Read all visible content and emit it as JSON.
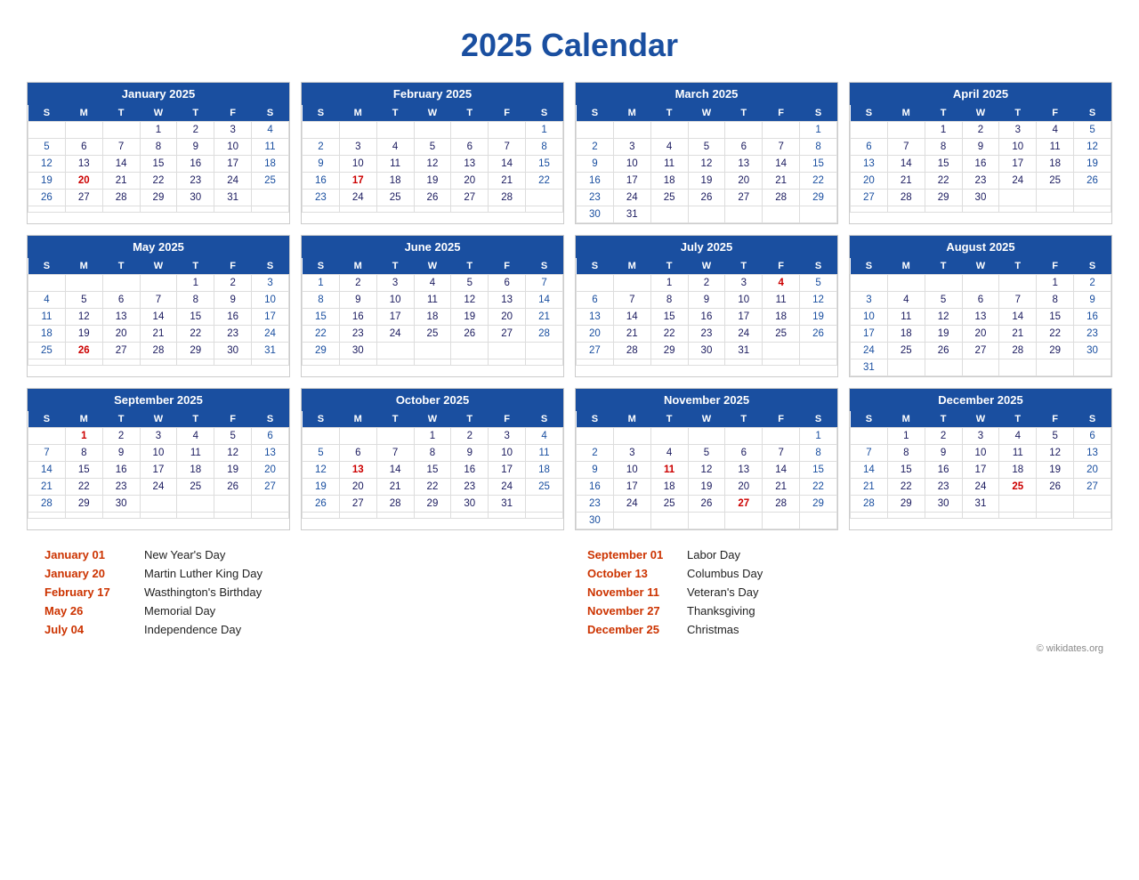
{
  "title": "2025 Calendar",
  "months": [
    {
      "name": "January 2025",
      "weeks": [
        [
          "",
          "",
          "",
          "1",
          "2",
          "3",
          "4"
        ],
        [
          "5",
          "6",
          "7",
          "8",
          "9",
          "10",
          "11"
        ],
        [
          "12",
          "13",
          "14",
          "15",
          "16",
          "17",
          "18"
        ],
        [
          "19",
          "20h",
          "21",
          "22",
          "23",
          "24",
          "25"
        ],
        [
          "26",
          "27",
          "28",
          "29",
          "30",
          "31",
          ""
        ],
        [
          "",
          "",
          "",
          "",
          "",
          "",
          ""
        ]
      ],
      "holidays": [
        "1",
        "20"
      ]
    },
    {
      "name": "February 2025",
      "weeks": [
        [
          "",
          "",
          "",
          "",
          "",
          "",
          "1"
        ],
        [
          "2",
          "3",
          "4",
          "5",
          "6",
          "7",
          "8"
        ],
        [
          "9",
          "10",
          "11",
          "12",
          "13",
          "14",
          "15"
        ],
        [
          "16",
          "17h",
          "18",
          "19",
          "20",
          "21",
          "22"
        ],
        [
          "23",
          "24",
          "25",
          "26",
          "27",
          "28",
          ""
        ],
        [
          "",
          "",
          "",
          "",
          "",
          "",
          ""
        ]
      ],
      "holidays": [
        "17"
      ]
    },
    {
      "name": "March 2025",
      "weeks": [
        [
          "",
          "",
          "",
          "",
          "",
          "",
          "1"
        ],
        [
          "2",
          "3",
          "4",
          "5",
          "6",
          "7",
          "8"
        ],
        [
          "9",
          "10",
          "11",
          "12",
          "13",
          "14",
          "15"
        ],
        [
          "16",
          "17",
          "18",
          "19",
          "20",
          "21",
          "22"
        ],
        [
          "23",
          "24",
          "25",
          "26",
          "27",
          "28",
          "29"
        ],
        [
          "30",
          "31",
          "",
          "",
          "",
          "",
          ""
        ]
      ],
      "holidays": []
    },
    {
      "name": "April 2025",
      "weeks": [
        [
          "",
          "",
          "1",
          "2",
          "3",
          "4",
          "5"
        ],
        [
          "6",
          "7",
          "8",
          "9",
          "10",
          "11",
          "12"
        ],
        [
          "13",
          "14",
          "15",
          "16",
          "17",
          "18",
          "19"
        ],
        [
          "20",
          "21",
          "22",
          "23",
          "24",
          "25",
          "26"
        ],
        [
          "27",
          "28",
          "29",
          "30",
          "",
          "",
          ""
        ],
        [
          "",
          "",
          "",
          "",
          "",
          "",
          ""
        ]
      ],
      "holidays": []
    },
    {
      "name": "May 2025",
      "weeks": [
        [
          "",
          "",
          "",
          "",
          "1",
          "2",
          "3"
        ],
        [
          "4",
          "5",
          "6",
          "7",
          "8",
          "9",
          "10"
        ],
        [
          "11",
          "12",
          "13",
          "14",
          "15",
          "16",
          "17"
        ],
        [
          "18",
          "19",
          "20",
          "21",
          "22",
          "23",
          "24"
        ],
        [
          "25",
          "26h",
          "27",
          "28",
          "29",
          "30",
          "31"
        ],
        [
          "",
          "",
          "",
          "",
          "",
          "",
          ""
        ]
      ],
      "holidays": [
        "26"
      ]
    },
    {
      "name": "June 2025",
      "weeks": [
        [
          "1",
          "2",
          "3",
          "4",
          "5",
          "6",
          "7"
        ],
        [
          "8",
          "9",
          "10",
          "11",
          "12",
          "13",
          "14"
        ],
        [
          "15",
          "16",
          "17",
          "18",
          "19",
          "20",
          "21"
        ],
        [
          "22",
          "23",
          "24",
          "25",
          "26",
          "27",
          "28"
        ],
        [
          "29",
          "30",
          "",
          "",
          "",
          "",
          ""
        ],
        [
          "",
          "",
          "",
          "",
          "",
          "",
          ""
        ]
      ],
      "holidays": []
    },
    {
      "name": "July 2025",
      "weeks": [
        [
          "",
          "",
          "1",
          "2",
          "3",
          "4h",
          "5"
        ],
        [
          "6",
          "7",
          "8",
          "9",
          "10",
          "11",
          "12"
        ],
        [
          "13",
          "14",
          "15",
          "16",
          "17",
          "18",
          "19"
        ],
        [
          "20",
          "21",
          "22",
          "23",
          "24",
          "25",
          "26"
        ],
        [
          "27",
          "28",
          "29",
          "30",
          "31",
          "",
          ""
        ],
        [
          "",
          "",
          "",
          "",
          "",
          "",
          ""
        ]
      ],
      "holidays": [
        "4"
      ]
    },
    {
      "name": "August 2025",
      "weeks": [
        [
          "",
          "",
          "",
          "",
          "",
          "1",
          "2"
        ],
        [
          "3",
          "4",
          "5",
          "6",
          "7",
          "8",
          "9"
        ],
        [
          "10",
          "11",
          "12",
          "13",
          "14",
          "15",
          "16"
        ],
        [
          "17",
          "18",
          "19",
          "20",
          "21",
          "22",
          "23"
        ],
        [
          "24",
          "25",
          "26",
          "27",
          "28",
          "29",
          "30"
        ],
        [
          "31",
          "",
          "",
          "",
          "",
          "",
          ""
        ]
      ],
      "holidays": []
    },
    {
      "name": "September 2025",
      "weeks": [
        [
          "",
          "1h",
          "2",
          "3",
          "4",
          "5",
          "6"
        ],
        [
          "7",
          "8",
          "9",
          "10",
          "11",
          "12",
          "13"
        ],
        [
          "14",
          "15",
          "16",
          "17",
          "18",
          "19",
          "20"
        ],
        [
          "21",
          "22",
          "23",
          "24",
          "25",
          "26",
          "27"
        ],
        [
          "28",
          "29",
          "30",
          "",
          "",
          "",
          ""
        ],
        [
          "",
          "",
          "",
          "",
          "",
          "",
          ""
        ]
      ],
      "holidays": [
        "1"
      ]
    },
    {
      "name": "October 2025",
      "weeks": [
        [
          "",
          "",
          "",
          "1",
          "2",
          "3",
          "4"
        ],
        [
          "5",
          "6",
          "7",
          "8",
          "9",
          "10",
          "11"
        ],
        [
          "12",
          "13h",
          "14",
          "15",
          "16",
          "17",
          "18"
        ],
        [
          "19",
          "20",
          "21",
          "22",
          "23",
          "24",
          "25"
        ],
        [
          "26",
          "27",
          "28",
          "29",
          "30",
          "31",
          ""
        ],
        [
          "",
          "",
          "",
          "",
          "",
          "",
          ""
        ]
      ],
      "holidays": [
        "13"
      ]
    },
    {
      "name": "November 2025",
      "weeks": [
        [
          "",
          "",
          "",
          "",
          "",
          "",
          "1"
        ],
        [
          "2",
          "3",
          "4",
          "5",
          "6",
          "7",
          "8"
        ],
        [
          "9",
          "10",
          "11h",
          "12",
          "13",
          "14",
          "15"
        ],
        [
          "16",
          "17",
          "18",
          "19",
          "20",
          "21",
          "22"
        ],
        [
          "23",
          "24",
          "25",
          "26",
          "27h",
          "28",
          "29"
        ],
        [
          "30",
          "",
          "",
          "",
          "",
          "",
          ""
        ]
      ],
      "holidays": [
        "11",
        "27"
      ]
    },
    {
      "name": "December 2025",
      "weeks": [
        [
          "",
          "1",
          "2",
          "3",
          "4",
          "5",
          "6"
        ],
        [
          "7",
          "8",
          "9",
          "10",
          "11",
          "12",
          "13"
        ],
        [
          "14",
          "15",
          "16",
          "17",
          "18",
          "19",
          "20"
        ],
        [
          "21",
          "22",
          "23",
          "24",
          "25h",
          "26",
          "27"
        ],
        [
          "28",
          "29",
          "30",
          "31",
          "",
          "",
          ""
        ],
        [
          "",
          "",
          "",
          "",
          "",
          "",
          ""
        ]
      ],
      "holidays": [
        "25"
      ]
    }
  ],
  "holidays_left": [
    {
      "date": "January 01",
      "name": "New Year's Day"
    },
    {
      "date": "January 20",
      "name": "Martin Luther King Day"
    },
    {
      "date": "February 17",
      "name": "Wasthington's Birthday"
    },
    {
      "date": "May 26",
      "name": "Memorial Day"
    },
    {
      "date": "July 04",
      "name": "Independence Day"
    }
  ],
  "holidays_right": [
    {
      "date": "September 01",
      "name": "Labor Day"
    },
    {
      "date": "October 13",
      "name": "Columbus Day"
    },
    {
      "date": "November 11",
      "name": "Veteran's Day"
    },
    {
      "date": "November 27",
      "name": "Thanksgiving"
    },
    {
      "date": "December 25",
      "name": "Christmas"
    }
  ],
  "footer": "© wikidates.org",
  "days_header": [
    "S",
    "M",
    "T",
    "W",
    "T",
    "F",
    "S"
  ]
}
